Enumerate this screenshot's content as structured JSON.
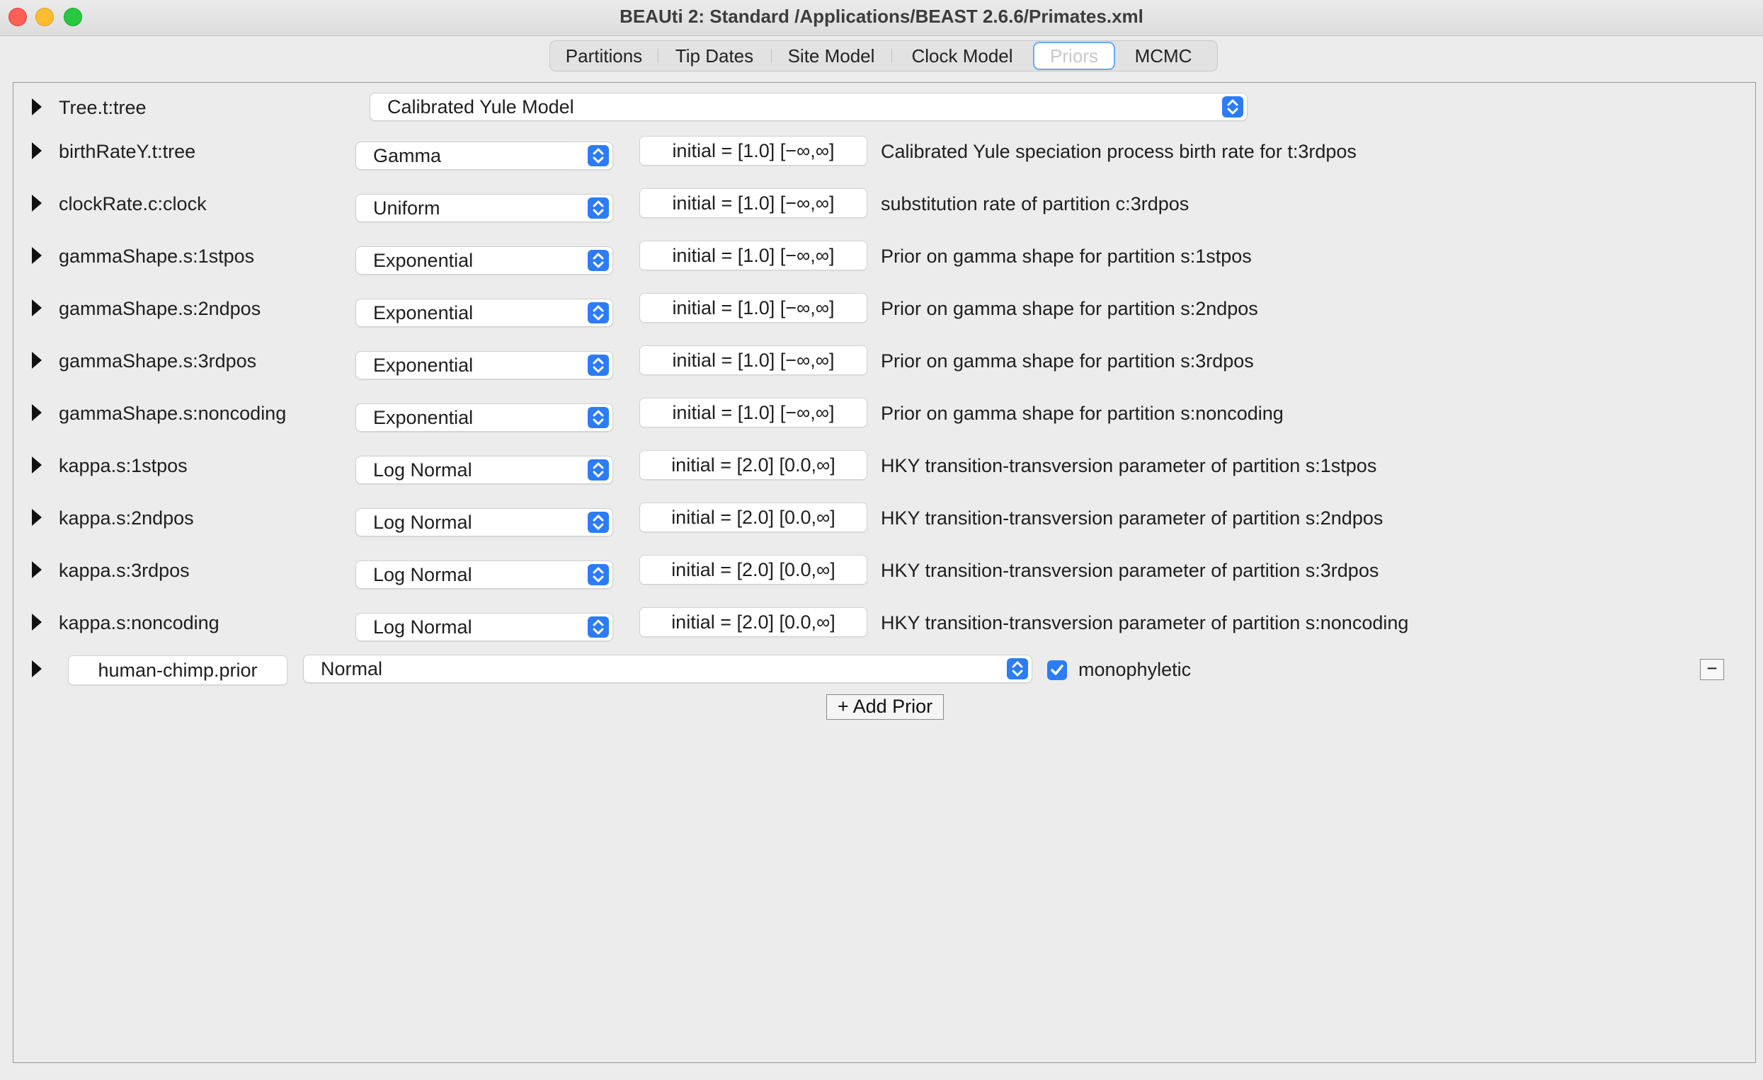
{
  "window": {
    "title": "BEAUti 2: Standard /Applications/BEAST 2.6.6/Primates.xml"
  },
  "tabs": [
    {
      "label": "Partitions"
    },
    {
      "label": "Tip Dates"
    },
    {
      "label": "Site Model"
    },
    {
      "label": "Clock Model"
    },
    {
      "label": "Priors"
    },
    {
      "label": "MCMC"
    }
  ],
  "selected_tab": "Priors",
  "tree_prior": {
    "name": "Tree.t:tree",
    "model": "Calibrated Yule Model"
  },
  "priors": [
    {
      "name": "birthRateY.t:tree",
      "distribution": "Gamma",
      "initial": "initial = [1.0] [−∞,∞]",
      "description": "Calibrated Yule speciation process birth rate for t:3rdpos"
    },
    {
      "name": "clockRate.c:clock",
      "distribution": "Uniform",
      "initial": "initial = [1.0] [−∞,∞]",
      "description": "substitution rate of partition c:3rdpos"
    },
    {
      "name": "gammaShape.s:1stpos",
      "distribution": "Exponential",
      "initial": "initial = [1.0] [−∞,∞]",
      "description": "Prior on gamma shape for partition s:1stpos"
    },
    {
      "name": "gammaShape.s:2ndpos",
      "distribution": "Exponential",
      "initial": "initial = [1.0] [−∞,∞]",
      "description": "Prior on gamma shape for partition s:2ndpos"
    },
    {
      "name": "gammaShape.s:3rdpos",
      "distribution": "Exponential",
      "initial": "initial = [1.0] [−∞,∞]",
      "description": "Prior on gamma shape for partition s:3rdpos"
    },
    {
      "name": "gammaShape.s:noncoding",
      "distribution": "Exponential",
      "initial": "initial = [1.0] [−∞,∞]",
      "description": "Prior on gamma shape for partition s:noncoding"
    },
    {
      "name": "kappa.s:1stpos",
      "distribution": "Log Normal",
      "initial": "initial = [2.0] [0.0,∞]",
      "description": "HKY transition-transversion parameter of partition s:1stpos"
    },
    {
      "name": "kappa.s:2ndpos",
      "distribution": "Log Normal",
      "initial": "initial = [2.0] [0.0,∞]",
      "description": "HKY transition-transversion parameter of partition s:2ndpos"
    },
    {
      "name": "kappa.s:3rdpos",
      "distribution": "Log Normal",
      "initial": "initial = [2.0] [0.0,∞]",
      "description": "HKY transition-transversion parameter of partition s:3rdpos"
    },
    {
      "name": "kappa.s:noncoding",
      "distribution": "Log Normal",
      "initial": "initial = [2.0] [0.0,∞]",
      "description": "HKY transition-transversion parameter of partition s:noncoding"
    }
  ],
  "mrca_prior": {
    "name": "human-chimp.prior",
    "distribution": "Normal",
    "monophyletic_label": "monophyletic",
    "monophyletic_checked": true,
    "remove_label": "−"
  },
  "add_prior_label": "+ Add Prior",
  "colors": {
    "accent": "#2c7cf6",
    "selected_tab_border": "#6aa8f0"
  }
}
